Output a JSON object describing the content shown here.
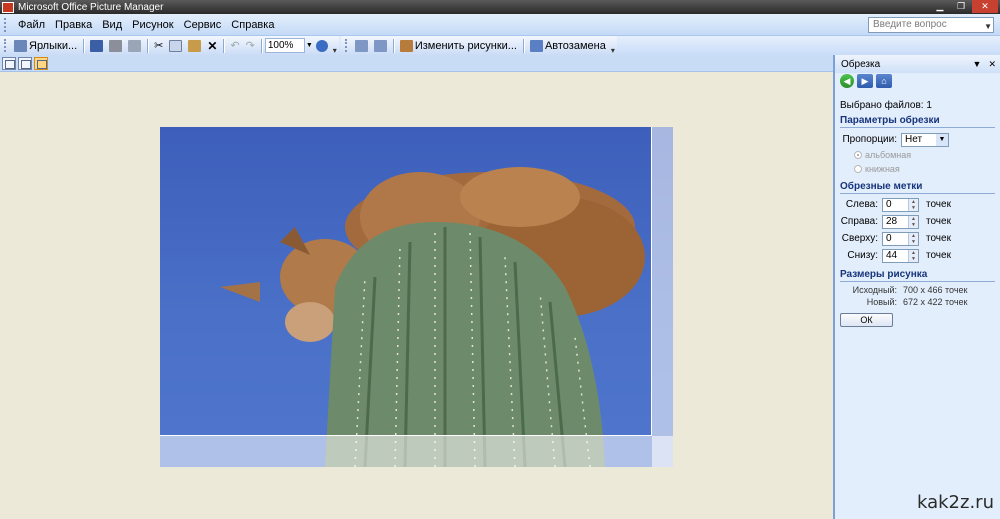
{
  "window": {
    "title": "Microsoft Office Picture Manager"
  },
  "menu": {
    "items": [
      "Файл",
      "Правка",
      "Вид",
      "Рисунок",
      "Сервис",
      "Справка"
    ],
    "help_placeholder": "Введите вопрос"
  },
  "toolbar": {
    "shortcuts_label": "Ярлыки...",
    "zoom_value": "100%",
    "edit_pictures_label": "Изменить рисунки...",
    "autofix_label": "Автозамена"
  },
  "taskpane": {
    "title": "Обрезка",
    "files_selected": "Выбрано файлов: 1",
    "crop_params_title": "Параметры обрезки",
    "proportions_label": "Пропорции:",
    "proportions_value": "Нет",
    "landscape_label": "альбомная",
    "portrait_label": "книжная",
    "crop_marks_title": "Обрезные метки",
    "marks": [
      {
        "label": "Слева:",
        "value": "0",
        "unit": "точек"
      },
      {
        "label": "Справа:",
        "value": "28",
        "unit": "точек"
      },
      {
        "label": "Сверху:",
        "value": "0",
        "unit": "точек"
      },
      {
        "label": "Снизу:",
        "value": "44",
        "unit": "точек"
      }
    ],
    "size_title": "Размеры рисунка",
    "original_label": "Исходный:",
    "original_value": "700 x 466 точек",
    "new_label": "Новый:",
    "new_value": "672 x 422 точек",
    "ok_label": "ОК"
  },
  "watermark": "kak2z.ru"
}
